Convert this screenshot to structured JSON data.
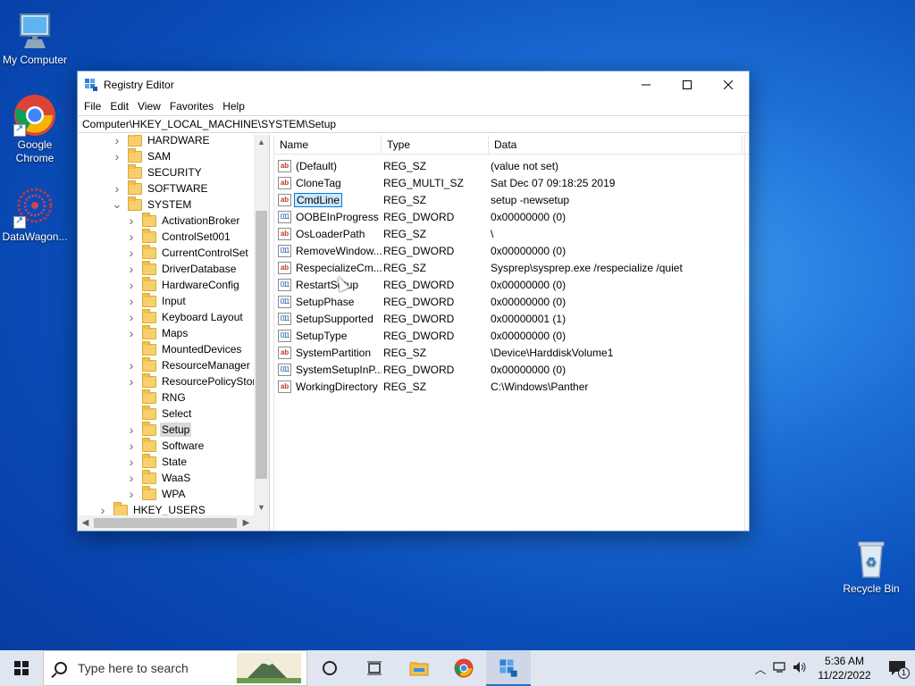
{
  "desktop": {
    "icons": [
      {
        "label": "My Computer",
        "icon": "monitor-icon"
      },
      {
        "label": "Google Chrome",
        "icon": "chrome-icon"
      },
      {
        "label": "DataWagon...",
        "icon": "datawagon-icon"
      },
      {
        "label": "Recycle Bin",
        "icon": "recycle-bin-icon"
      }
    ]
  },
  "window": {
    "title": "Registry Editor",
    "menu": [
      "File",
      "Edit",
      "View",
      "Favorites",
      "Help"
    ],
    "address": "Computer\\HKEY_LOCAL_MACHINE\\SYSTEM\\Setup",
    "tree": [
      {
        "label": "HARDWARE",
        "level": 1,
        "chevron": ">"
      },
      {
        "label": "SAM",
        "level": 1,
        "chevron": ">"
      },
      {
        "label": "SECURITY",
        "level": 1,
        "chevron": ""
      },
      {
        "label": "SOFTWARE",
        "level": 1,
        "chevron": ">"
      },
      {
        "label": "SYSTEM",
        "level": 1,
        "chevron": "v"
      },
      {
        "label": "ActivationBroker",
        "level": 2,
        "chevron": ">"
      },
      {
        "label": "ControlSet001",
        "level": 2,
        "chevron": ">"
      },
      {
        "label": "CurrentControlSet",
        "level": 2,
        "chevron": ">"
      },
      {
        "label": "DriverDatabase",
        "level": 2,
        "chevron": ">"
      },
      {
        "label": "HardwareConfig",
        "level": 2,
        "chevron": ">"
      },
      {
        "label": "Input",
        "level": 2,
        "chevron": ">"
      },
      {
        "label": "Keyboard Layout",
        "level": 2,
        "chevron": ">"
      },
      {
        "label": "Maps",
        "level": 2,
        "chevron": ">"
      },
      {
        "label": "MountedDevices",
        "level": 2,
        "chevron": ""
      },
      {
        "label": "ResourceManager",
        "level": 2,
        "chevron": ">"
      },
      {
        "label": "ResourcePolicyStore",
        "level": 2,
        "chevron": ">"
      },
      {
        "label": "RNG",
        "level": 2,
        "chevron": ""
      },
      {
        "label": "Select",
        "level": 2,
        "chevron": ""
      },
      {
        "label": "Setup",
        "level": 2,
        "chevron": ">",
        "selected": true
      },
      {
        "label": "Software",
        "level": 2,
        "chevron": ">"
      },
      {
        "label": "State",
        "level": 2,
        "chevron": ">"
      },
      {
        "label": "WaaS",
        "level": 2,
        "chevron": ">"
      },
      {
        "label": "WPA",
        "level": 2,
        "chevron": ">"
      },
      {
        "label": "HKEY_USERS",
        "level": 0,
        "chevron": ">"
      }
    ],
    "columns": {
      "name": "Name",
      "type": "Type",
      "data": "Data"
    },
    "values": [
      {
        "name": "(Default)",
        "type": "REG_SZ",
        "data": "(value not set)",
        "kind": "sz"
      },
      {
        "name": "CloneTag",
        "type": "REG_MULTI_SZ",
        "data": "Sat Dec 07 09:18:25 2019",
        "kind": "sz"
      },
      {
        "name": "CmdLine",
        "type": "REG_SZ",
        "data": "setup -newsetup",
        "kind": "sz",
        "selected": true
      },
      {
        "name": "OOBEInProgress",
        "type": "REG_DWORD",
        "data": "0x00000000 (0)",
        "kind": "bin"
      },
      {
        "name": "OsLoaderPath",
        "type": "REG_SZ",
        "data": "\\",
        "kind": "sz"
      },
      {
        "name": "RemoveWindow...",
        "type": "REG_DWORD",
        "data": "0x00000000 (0)",
        "kind": "bin"
      },
      {
        "name": "RespecializeCm...",
        "type": "REG_SZ",
        "data": "Sysprep\\sysprep.exe /respecialize /quiet",
        "kind": "sz"
      },
      {
        "name": "RestartSetup",
        "type": "REG_DWORD",
        "data": "0x00000000 (0)",
        "kind": "bin"
      },
      {
        "name": "SetupPhase",
        "type": "REG_DWORD",
        "data": "0x00000000 (0)",
        "kind": "bin"
      },
      {
        "name": "SetupSupported",
        "type": "REG_DWORD",
        "data": "0x00000001 (1)",
        "kind": "bin"
      },
      {
        "name": "SetupType",
        "type": "REG_DWORD",
        "data": "0x00000000 (0)",
        "kind": "bin"
      },
      {
        "name": "SystemPartition",
        "type": "REG_SZ",
        "data": "\\Device\\HarddiskVolume1",
        "kind": "sz"
      },
      {
        "name": "SystemSetupInP...",
        "type": "REG_DWORD",
        "data": "0x00000000 (0)",
        "kind": "bin"
      },
      {
        "name": "WorkingDirectory",
        "type": "REG_SZ",
        "data": "C:\\Windows\\Panther",
        "kind": "sz"
      }
    ]
  },
  "taskbar": {
    "search_placeholder": "Type here to search",
    "time": "5:36 AM",
    "date": "11/22/2022",
    "notification_count": "1"
  }
}
